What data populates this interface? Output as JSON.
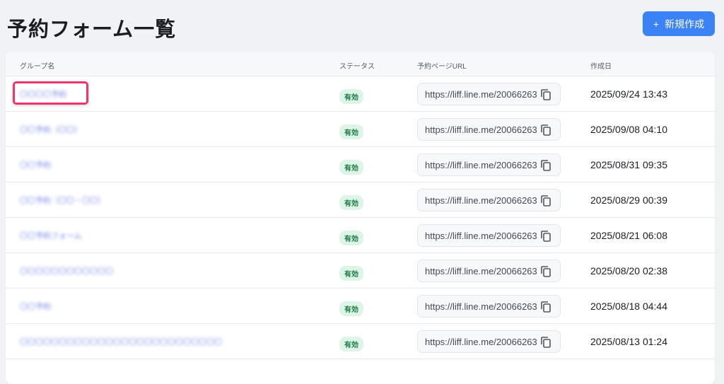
{
  "header": {
    "title": "予約フォーム一覧",
    "new_button": "新規作成",
    "new_icon": "+"
  },
  "table": {
    "columns": [
      "グループ名",
      "ステータス",
      "予約ページURL",
      "作成日"
    ],
    "rows": [
      {
        "name": "〇〇〇〇予約",
        "status": "有効",
        "url": "https://liff.line.me/20066263",
        "date": "2025/09/24 13:43",
        "highlighted": true
      },
      {
        "name": "〇〇予約（〇〇）",
        "status": "有効",
        "url": "https://liff.line.me/20066263",
        "date": "2025/09/08 04:10"
      },
      {
        "name": "〇〇予約",
        "status": "有効",
        "url": "https://liff.line.me/20066263",
        "date": "2025/08/31 09:35"
      },
      {
        "name": "〇〇予約（〇〇・〇〇）",
        "status": "有効",
        "url": "https://liff.line.me/20066263",
        "date": "2025/08/29 00:39"
      },
      {
        "name": "〇〇予約フォーム",
        "status": "有効",
        "url": "https://liff.line.me/20066263",
        "date": "2025/08/21 06:08"
      },
      {
        "name": "〇〇〇〇〇〇〇〇〇〇〇〇",
        "status": "有効",
        "url": "https://liff.line.me/20066263",
        "date": "2025/08/20 02:38"
      },
      {
        "name": "〇〇予約",
        "status": "有効",
        "url": "https://liff.line.me/20066263",
        "date": "2025/08/18 04:44"
      },
      {
        "name": "〇〇〇〇〇〇〇〇〇〇〇〇〇〇〇〇〇〇〇〇〇〇〇〇〇〇",
        "status": "有効",
        "url": "https://liff.line.me/20066263",
        "date": "2025/08/13 01:24"
      },
      {
        "name": "",
        "status": "",
        "url": "",
        "date": ""
      }
    ]
  }
}
